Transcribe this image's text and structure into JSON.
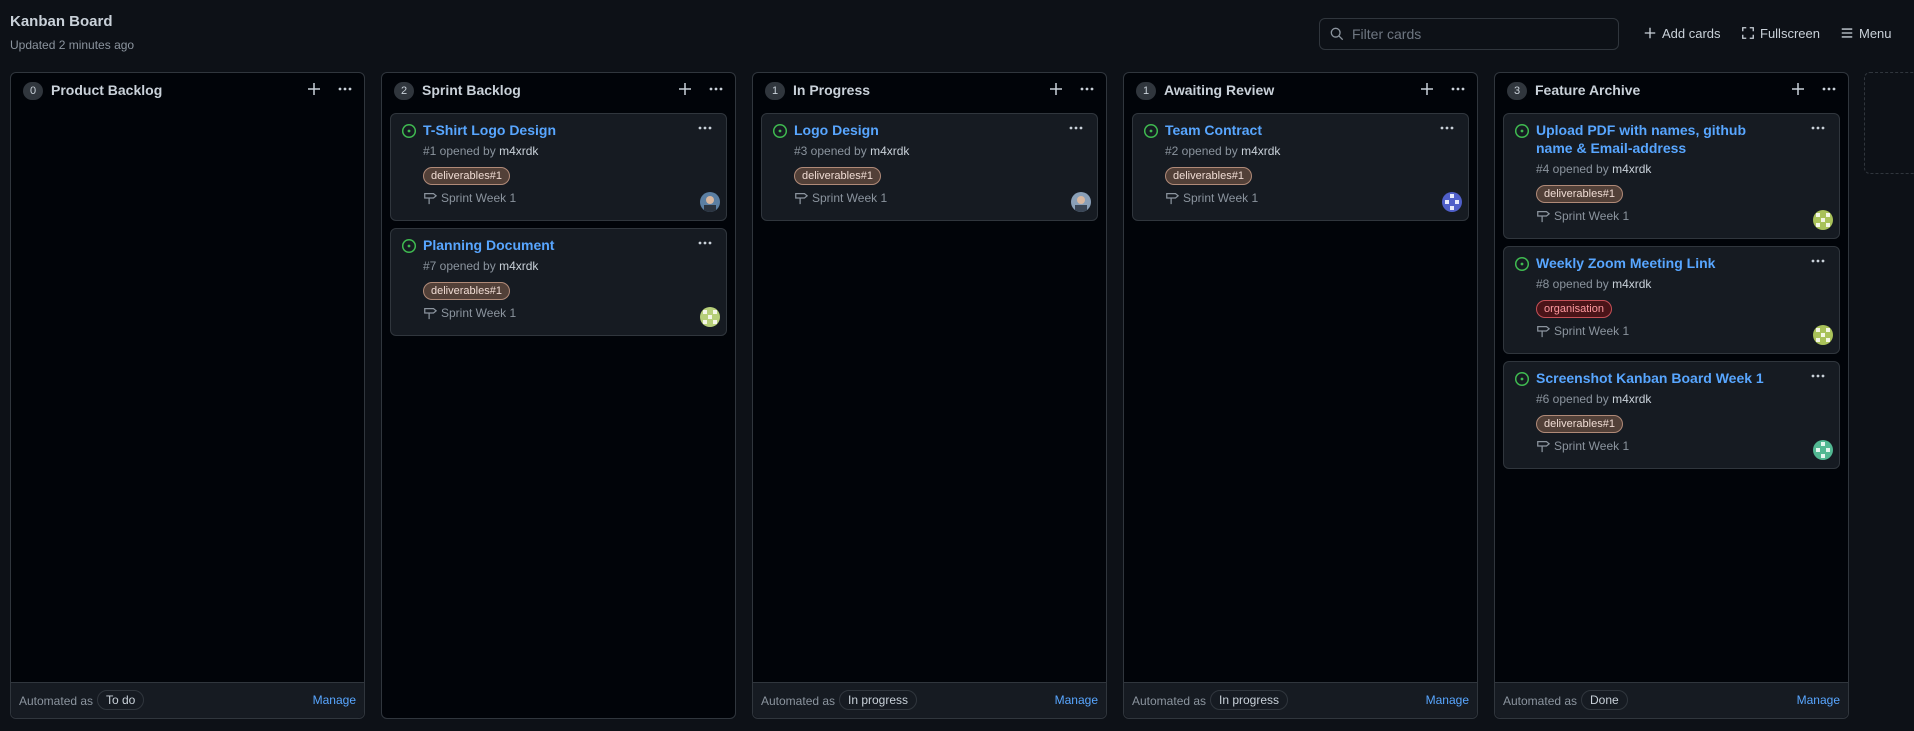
{
  "board": {
    "title": "Kanban Board",
    "updated": "Updated 2 minutes ago",
    "filter_placeholder": "Filter cards",
    "add_cards": "Add cards",
    "fullscreen": "Fullscreen",
    "menu": "Menu"
  },
  "footer": {
    "automated_as": "Automated as",
    "manage": "Manage"
  },
  "columns": [
    {
      "count": "0",
      "name": "Product Backlog",
      "automation": "To do",
      "cards": []
    },
    {
      "count": "2",
      "name": "Sprint Backlog",
      "automation": "",
      "cards": [
        {
          "title": "T-Shirt Logo Design",
          "number": "#1 opened by",
          "author": "m4xrdk",
          "label": "deliverables#1",
          "milestone": "Sprint Week 1"
        },
        {
          "title": "Planning Document",
          "number": "#7 opened by",
          "author": "m4xrdk",
          "label": "deliverables#1",
          "milestone": "Sprint Week 1"
        }
      ]
    },
    {
      "count": "1",
      "name": "In Progress",
      "automation": "In progress",
      "cards": [
        {
          "title": "Logo Design",
          "number": "#3 opened by",
          "author": "m4xrdk",
          "label": "deliverables#1",
          "milestone": "Sprint Week 1"
        }
      ]
    },
    {
      "count": "1",
      "name": "Awaiting Review",
      "automation": "In progress",
      "cards": [
        {
          "title": "Team Contract",
          "number": "#2 opened by",
          "author": "m4xrdk",
          "label": "deliverables#1",
          "milestone": "Sprint Week 1"
        }
      ]
    },
    {
      "count": "3",
      "name": "Feature Archive",
      "automation": "Done",
      "cards": [
        {
          "title": "Upload PDF with names, github name & Email-address",
          "number": "#4 opened by",
          "author": "m4xrdk",
          "label": "deliverables#1",
          "milestone": "Sprint Week 1"
        },
        {
          "title": "Weekly Zoom Meeting Link",
          "number": "#8 opened by",
          "author": "m4xrdk",
          "label": "organisation",
          "milestone": "Sprint Week 1"
        },
        {
          "title": "Screenshot Kanban Board Week 1",
          "number": "#6 opened by",
          "author": "m4xrdk",
          "label": "deliverables#1",
          "milestone": "Sprint Week 1"
        }
      ]
    }
  ],
  "colors": {
    "background": "#0d1117",
    "column_bg": "#010409",
    "card_bg": "#161b22",
    "border": "#30363d",
    "link": "#58a6ff",
    "open_issue": "#3fb950",
    "label_deliverables": "#524038",
    "label_organisation": "#4a1418"
  },
  "icons": {
    "open_issue": "issue-opened-icon",
    "milestone": "milestone-icon",
    "search": "search-icon",
    "add": "plus-icon",
    "fullscreen": "fullscreen-icon",
    "menu": "hamburger-icon",
    "more": "kebab-horizontal-icon"
  }
}
